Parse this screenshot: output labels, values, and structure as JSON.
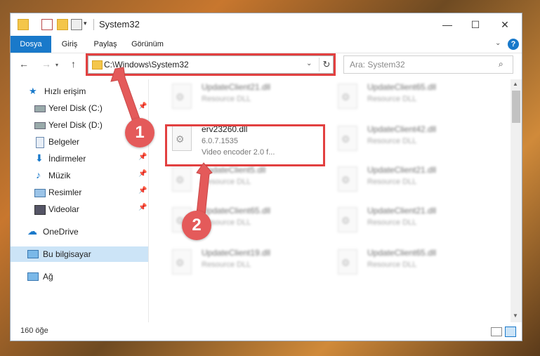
{
  "window": {
    "title": "System32"
  },
  "controls": {
    "minimize": "—",
    "maximize": "☐",
    "close": "✕"
  },
  "ribbon": {
    "tabs": [
      "Dosya",
      "Giriş",
      "Paylaş",
      "Görünüm"
    ],
    "help": "?"
  },
  "address": {
    "path": "C:\\Windows\\System32"
  },
  "search": {
    "placeholder": "Ara: System32"
  },
  "sidebar": {
    "items": [
      {
        "label": "Hızlı erişim",
        "icon": "star-icon",
        "pinned": false
      },
      {
        "label": "Yerel Disk (C:)",
        "icon": "drive-icon",
        "pinned": true
      },
      {
        "label": "Yerel Disk (D:)",
        "icon": "drive-icon",
        "pinned": false
      },
      {
        "label": "Belgeler",
        "icon": "documents-icon",
        "pinned": true
      },
      {
        "label": "İndirmeler",
        "icon": "download-icon",
        "pinned": true
      },
      {
        "label": "Müzik",
        "icon": "music-icon",
        "pinned": true
      },
      {
        "label": "Resimler",
        "icon": "pictures-icon",
        "pinned": true
      },
      {
        "label": "Videolar",
        "icon": "videos-icon",
        "pinned": true
      },
      {
        "label": "OneDrive",
        "icon": "cloud-icon",
        "pinned": false
      },
      {
        "label": "Bu bilgisayar",
        "icon": "computer-icon",
        "pinned": false
      },
      {
        "label": "Ağ",
        "icon": "network-icon",
        "pinned": false
      }
    ]
  },
  "files": [
    {
      "name": "UpdateClient21.dll",
      "type": "Resource DLL"
    },
    {
      "name": "UpdateClient65.dll",
      "type": "Resource DLL"
    },
    {
      "name": "erv23260.dll",
      "version": "6.0.7.1535",
      "description": "Video encoder 2.0 f..."
    },
    {
      "name": "UpdateClient42.dll",
      "type": "Resource DLL"
    },
    {
      "name": "UpdateClient5.dll",
      "type": "Resource DLL"
    },
    {
      "name": "UpdateClient21.dll",
      "type": "Resource DLL"
    },
    {
      "name": "UpdateClient65.dll",
      "type": "Resource DLL"
    },
    {
      "name": "UpdateClient21.dll",
      "type": "Resource DLL"
    },
    {
      "name": "UpdateClient19.dll",
      "type": "Resource DLL"
    },
    {
      "name": "UpdateClient65.dll",
      "type": "Resource DLL"
    }
  ],
  "status": {
    "count": "160 öğe"
  },
  "annotations": {
    "badge1": "1",
    "badge2": "2"
  },
  "colors": {
    "accent": "#1979ca",
    "highlight": "#e24040",
    "badge": "#e45a5a"
  }
}
